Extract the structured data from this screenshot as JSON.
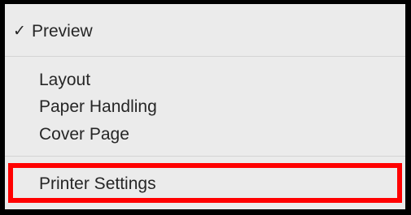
{
  "menu": {
    "items": [
      {
        "label": "Preview",
        "checked": true,
        "check_glyph": "✓"
      },
      {
        "label": "Layout"
      },
      {
        "label": "Paper Handling"
      },
      {
        "label": "Cover Page"
      },
      {
        "label": "Printer Settings",
        "highlighted": true
      }
    ]
  },
  "colors": {
    "menu_background": "#ebebeb",
    "text": "#262626",
    "separator": "#d4d4d4",
    "highlight_border": "#ff0000",
    "frame": "#000000"
  }
}
